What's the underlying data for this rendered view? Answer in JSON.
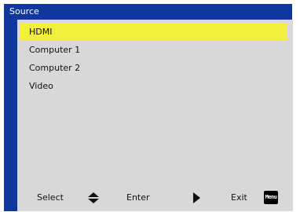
{
  "title": "Source",
  "items": [
    {
      "label": "HDMI",
      "selected": true
    },
    {
      "label": "Computer 1",
      "selected": false
    },
    {
      "label": "Computer 2",
      "selected": false
    },
    {
      "label": "Video",
      "selected": false
    }
  ],
  "footer": {
    "select_label": "Select",
    "select_icon": "up-down-arrow-icon",
    "enter_label": "Enter",
    "enter_icon": "right-triangle-icon",
    "exit_label": "Exit",
    "exit_key_label": "Menu"
  },
  "colors": {
    "frame": "#10389c",
    "panel": "#d8d8d8",
    "highlight": "#f2ef3d"
  }
}
